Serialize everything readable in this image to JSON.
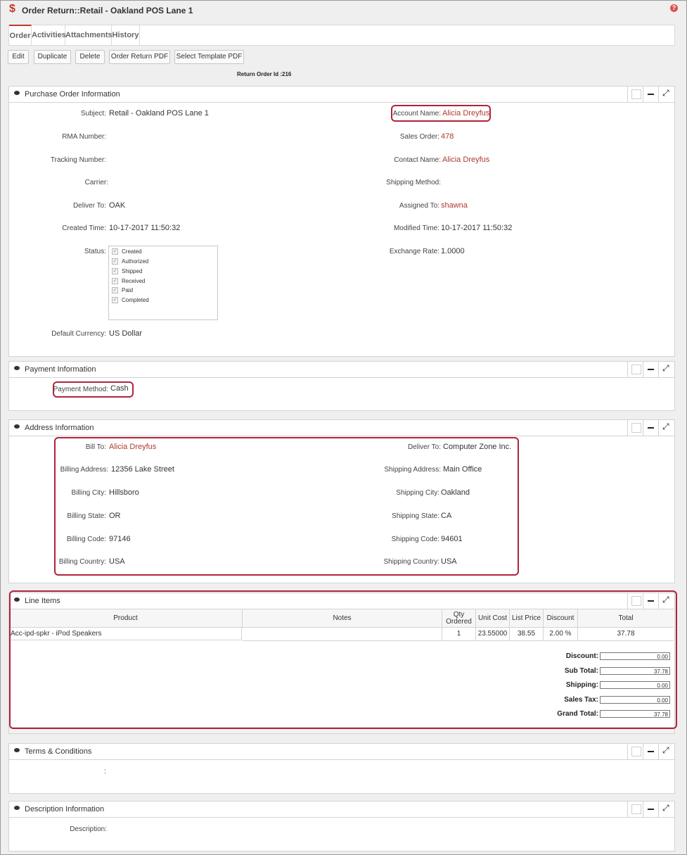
{
  "window": {
    "title": "Order Return::Retail - Oakland POS Lane 1",
    "title_icon": "$"
  },
  "tabs": [
    "Order",
    "Activities",
    "Attachments",
    "History"
  ],
  "toolbar": {
    "edit": "Edit",
    "duplicate": "Duplicate",
    "delete": "Delete",
    "order_return_pdf": "Order Return PDF",
    "select_template_pdf": "Select Template PDF"
  },
  "return_order_id": "Return Order Id :216",
  "purchase_order": {
    "title": "Purchase Order Information",
    "subject_label": "Subject:",
    "subject_value": "Retail - Oakland POS Lane 1",
    "account_label": "Account Name:",
    "account_value": "Alicia Dreyfus",
    "rma_label": "RMA Number:",
    "sales_order_label": "Sales Order:",
    "sales_order_value": "478",
    "tracking_label": "Tracking Number:",
    "contact_label": "Contact Name:",
    "contact_value": "Alicia Dreyfus",
    "carrier_label": "Carrier:",
    "shipping_method_label": "Shipping Method:",
    "deliver_label": "Deliver To:",
    "deliver_value": "OAK",
    "assigned_label": "Assigned To:",
    "assigned_value": "shawna",
    "created_label": "Created Time:",
    "created_value": "10-17-2017 11:50:32",
    "modified_label": "Modified Time:",
    "modified_value": "10-17-2017 11:50:32",
    "status_label": "Status:",
    "status_items": [
      "Created",
      "Authorized",
      "Shipped",
      "Received",
      "Paid",
      "Completed"
    ],
    "exchange_label": "Exchange Rate:",
    "exchange_value": "1.0000",
    "currency_label": "Default Currency:",
    "currency_value": "US Dollar"
  },
  "payment": {
    "title": "Payment Information",
    "method_label": "Payment Method:",
    "method_value": "Cash"
  },
  "address": {
    "title": "Address Information",
    "bill_to_label": "Bill To:",
    "bill_to_value": "Alicia Dreyfus",
    "deliver_to_label": "Deliver To:",
    "deliver_to_value": "Computer Zone Inc.",
    "billing_address_label": "Billing Address:",
    "billing_address_value": "12356 Lake Street",
    "shipping_address_label": "Shipping Address:",
    "shipping_address_value": "Main Office",
    "billing_city_label": "Billing City:",
    "billing_city_value": "Hillsboro",
    "shipping_city_label": "Shipping City:",
    "shipping_city_value": "Oakland",
    "billing_state_label": "Billing State:",
    "billing_state_value": "OR",
    "shipping_state_label": "Shipping State:",
    "shipping_state_value": "CA",
    "billing_code_label": "Billing Code:",
    "billing_code_value": "97146",
    "shipping_code_label": "Shipping Code:",
    "shipping_code_value": "94601",
    "billing_country_label": "Billing Country:",
    "billing_country_value": "USA",
    "shipping_country_label": "Shipping Country:",
    "shipping_country_value": "USA"
  },
  "line_items": {
    "title": "Line Items",
    "headers": [
      "Product",
      "Notes",
      "Qty Ordered",
      "Unit Cost",
      "List Price",
      "Discount",
      "Total"
    ],
    "rows": [
      {
        "product": "Acc-ipd-spkr - iPod Speakers",
        "notes": "",
        "qty": "1",
        "unit_cost": "23.55000",
        "list_price": "38.55",
        "discount": "2.00 %",
        "total": "37.78"
      }
    ],
    "totals": {
      "discount_label": "Discount:",
      "discount_value": "0.00",
      "subtotal_label": "Sub Total:",
      "subtotal_value": "37.78",
      "shipping_label": "Shipping:",
      "shipping_value": "0.00",
      "tax_label": "Sales Tax:",
      "tax_value": "0.00",
      "grand_label": "Grand Total:",
      "grand_value": "37.78"
    }
  },
  "terms": {
    "title": "Terms & Conditions",
    "separator": ":"
  },
  "description": {
    "title": "Description Information",
    "label": "Description:"
  },
  "colors": {
    "accent": "#c0392b",
    "link": "#b03a2e",
    "highlight": "#b0243a"
  }
}
